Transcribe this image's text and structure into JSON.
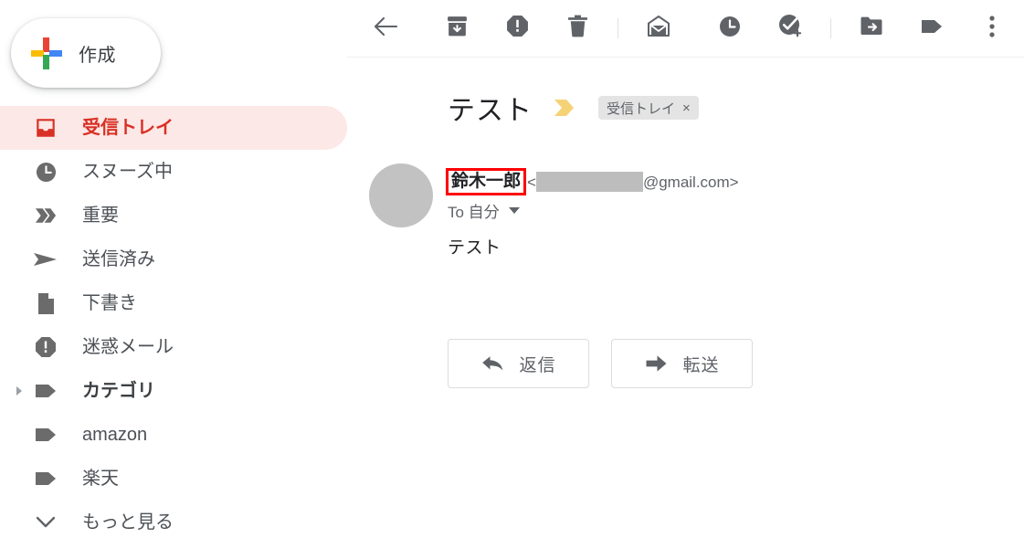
{
  "colors": {
    "gmail_red": "#d93025",
    "active_bg": "#fce8e6",
    "icon_gray": "#5f6368",
    "annotation_red": "#ff0000",
    "importance_yellow": "#f6d277",
    "redaction_gray": "#bdbdbd",
    "chip_gray": "#dddddd"
  },
  "sidebar": {
    "compose": {
      "label": "作成",
      "icon": "google-plus-icon"
    },
    "items": [
      {
        "label": "受信トレイ",
        "icon": "inbox-icon",
        "active": true,
        "bold": true,
        "disclosure": false
      },
      {
        "label": "スヌーズ中",
        "icon": "clock-icon",
        "active": false,
        "bold": false,
        "disclosure": false
      },
      {
        "label": "重要",
        "icon": "important-icon",
        "active": false,
        "bold": false,
        "disclosure": false
      },
      {
        "label": "送信済み",
        "icon": "sent-icon",
        "active": false,
        "bold": false,
        "disclosure": false
      },
      {
        "label": "下書き",
        "icon": "draft-icon",
        "active": false,
        "bold": false,
        "disclosure": false
      },
      {
        "label": "迷惑メール",
        "icon": "spam-icon",
        "active": false,
        "bold": false,
        "disclosure": false
      },
      {
        "label": "カテゴリ",
        "icon": "label-icon",
        "active": false,
        "bold": true,
        "disclosure": true
      },
      {
        "label": "amazon",
        "icon": "label-icon",
        "active": false,
        "bold": false,
        "disclosure": false
      },
      {
        "label": "楽天",
        "icon": "label-icon",
        "active": false,
        "bold": false,
        "disclosure": false
      },
      {
        "label": "もっと見る",
        "icon": "chevron-down-icon",
        "active": false,
        "bold": false,
        "disclosure": false
      }
    ]
  },
  "toolbar": {
    "back": "back-arrow-icon",
    "archive": "archive-icon",
    "report_spam": "report-spam-icon",
    "delete": "trash-icon",
    "mark_unread": "mark-unread-icon",
    "snooze": "clock-icon",
    "add_to_tasks": "add-to-tasks-icon",
    "move_to": "move-to-folder-icon",
    "labels": "label-icon",
    "more": "more-vertical-icon"
  },
  "message": {
    "subject": "テスト",
    "importance_marker": "importance-chevron-icon",
    "label_chip": {
      "text": "受信トレイ",
      "remove": "×"
    },
    "sender_name": "鈴木一郎",
    "address_open": "<",
    "address_domain": "@gmail.com>",
    "address_redacted": true,
    "recipient": "To 自分",
    "body": "テスト"
  },
  "actions": {
    "reply": {
      "label": "返信",
      "icon": "reply-arrow-icon"
    },
    "forward": {
      "label": "転送",
      "icon": "forward-arrow-icon"
    }
  }
}
